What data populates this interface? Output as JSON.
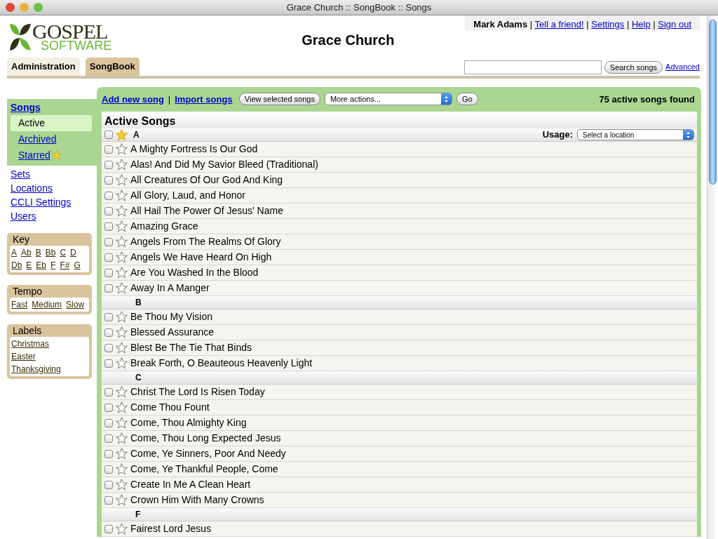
{
  "window": {
    "title": "Grace Church :: SongBook :: Songs"
  },
  "logo": {
    "line1": "GOSPEL",
    "line2": "SOFTWARE"
  },
  "church_name": "Grace Church",
  "user_bar": {
    "user": "Mark Adams",
    "separator": "|",
    "links": [
      "Tell a friend!",
      "Settings",
      "Help",
      "Sign out"
    ]
  },
  "tabs": [
    {
      "label": "Administration",
      "selected": false
    },
    {
      "label": "SongBook",
      "selected": true
    }
  ],
  "search": {
    "button": "Search songs",
    "advanced": "Advanced"
  },
  "sidebar": {
    "songs": {
      "label": "Songs",
      "items": [
        {
          "label": "Active",
          "selected": true
        },
        {
          "label": "Archived",
          "selected": false
        },
        {
          "label": "Starred",
          "selected": false
        }
      ]
    },
    "links": [
      "Sets",
      "Locations",
      "CCLI Settings",
      "Users"
    ],
    "panels": [
      {
        "title": "Key",
        "items": [
          "A",
          "Ab",
          "B",
          "Bb",
          "C",
          "D",
          "Db",
          "E",
          "Eb",
          "F",
          "F#",
          "G"
        ]
      },
      {
        "title": "Tempo",
        "items": [
          "Fast",
          "Medium",
          "Slow"
        ]
      },
      {
        "title": "Labels",
        "items": [
          "Christmas",
          "Easter",
          "Thanksgiving"
        ],
        "stacked": true
      }
    ]
  },
  "toolbar": {
    "separator": "|",
    "links": [
      "Add new song",
      "Import songs"
    ],
    "view_button": "View selected songs",
    "actions_select": "More actions...",
    "go_button": "Go",
    "count": "75 active songs found"
  },
  "list": {
    "title": "Active Songs",
    "header": {
      "letter": "A",
      "checked": false,
      "starred": true,
      "usage_label": "Usage:",
      "usage_select": "Select a location"
    },
    "groups": [
      {
        "songs": [
          {
            "title": "A Mighty Fortress Is Our God",
            "checked": false,
            "starred": false
          },
          {
            "title": "Alas! And Did My Savior Bleed (Traditional)",
            "checked": false,
            "starred": false
          },
          {
            "title": "All Creatures Of Our God And King",
            "checked": false,
            "starred": false
          },
          {
            "title": "All Glory, Laud, and Honor",
            "checked": false,
            "starred": false
          },
          {
            "title": "All Hail The Power Of Jesus' Name",
            "checked": false,
            "starred": false
          },
          {
            "title": "Amazing Grace",
            "checked": false,
            "starred": false
          },
          {
            "title": "Angels From The Realms Of Glory",
            "checked": false,
            "starred": false
          },
          {
            "title": "Angels We Have Heard On High",
            "checked": false,
            "starred": false
          },
          {
            "title": "Are You Washed In the Blood",
            "checked": false,
            "starred": false
          },
          {
            "title": "Away In A Manger",
            "checked": false,
            "starred": false
          }
        ]
      },
      {
        "letter": "B",
        "songs": [
          {
            "title": "Be Thou My Vision",
            "checked": false,
            "starred": false
          },
          {
            "title": "Blessed Assurance",
            "checked": false,
            "starred": false
          },
          {
            "title": "Blest Be The Tie That Binds",
            "checked": false,
            "starred": false
          },
          {
            "title": "Break Forth, O Beauteous Heavenly Light",
            "checked": false,
            "starred": false
          }
        ]
      },
      {
        "letter": "C",
        "songs": [
          {
            "title": "Christ The Lord Is Risen Today",
            "checked": false,
            "starred": false
          },
          {
            "title": "Come Thou Fount",
            "checked": false,
            "starred": false
          },
          {
            "title": "Come, Thou Almighty King",
            "checked": false,
            "starred": false
          },
          {
            "title": "Come, Thou Long Expected Jesus",
            "checked": false,
            "starred": false
          },
          {
            "title": "Come, Ye Sinners, Poor And Needy",
            "checked": false,
            "starred": false
          },
          {
            "title": "Come, Ye Thankful People, Come",
            "checked": false,
            "starred": false
          },
          {
            "title": "Create In Me A Clean Heart",
            "checked": false,
            "starred": false
          },
          {
            "title": "Crown Him With Many Crowns",
            "checked": false,
            "starred": false
          }
        ]
      },
      {
        "letter": "F",
        "songs": [
          {
            "title": "Fairest Lord Jesus",
            "checked": false,
            "starred": false
          }
        ]
      }
    ]
  }
}
